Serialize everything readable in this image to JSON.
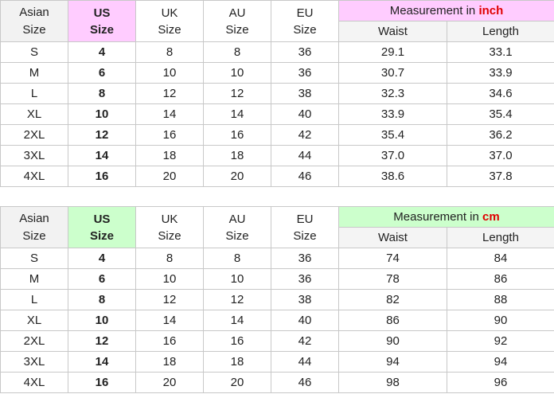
{
  "headers": {
    "asian_line1": "Asian",
    "asian_line2": "Size",
    "us_line1": "US",
    "us_line2": "Size",
    "uk_line1": "UK",
    "uk_line2": "Size",
    "au_line1": "AU",
    "au_line2": "Size",
    "eu_line1": "EU",
    "eu_line2": "Size",
    "measurement_prefix": "Measurement in ",
    "waist": "Waist",
    "length": "Length"
  },
  "tables": [
    {
      "unit": "inch",
      "us_header_color": "#ffccff",
      "measurement_header_color": "#ffccff",
      "rows": [
        {
          "asian": "S",
          "us": "4",
          "uk": "8",
          "au": "8",
          "eu": "36",
          "waist": "29.1",
          "length": "33.1"
        },
        {
          "asian": "M",
          "us": "6",
          "uk": "10",
          "au": "10",
          "eu": "36",
          "waist": "30.7",
          "length": "33.9"
        },
        {
          "asian": "L",
          "us": "8",
          "uk": "12",
          "au": "12",
          "eu": "38",
          "waist": "32.3",
          "length": "34.6"
        },
        {
          "asian": "XL",
          "us": "10",
          "uk": "14",
          "au": "14",
          "eu": "40",
          "waist": "33.9",
          "length": "35.4"
        },
        {
          "asian": "2XL",
          "us": "12",
          "uk": "16",
          "au": "16",
          "eu": "42",
          "waist": "35.4",
          "length": "36.2"
        },
        {
          "asian": "3XL",
          "us": "14",
          "uk": "18",
          "au": "18",
          "eu": "44",
          "waist": "37.0",
          "length": "37.0"
        },
        {
          "asian": "4XL",
          "us": "16",
          "uk": "20",
          "au": "20",
          "eu": "46",
          "waist": "38.6",
          "length": "37.8"
        }
      ]
    },
    {
      "unit": "cm",
      "us_header_color": "#ccffcc",
      "measurement_header_color": "#ccffcc",
      "rows": [
        {
          "asian": "S",
          "us": "4",
          "uk": "8",
          "au": "8",
          "eu": "36",
          "waist": "74",
          "length": "84"
        },
        {
          "asian": "M",
          "us": "6",
          "uk": "10",
          "au": "10",
          "eu": "36",
          "waist": "78",
          "length": "86"
        },
        {
          "asian": "L",
          "us": "8",
          "uk": "12",
          "au": "12",
          "eu": "38",
          "waist": "82",
          "length": "88"
        },
        {
          "asian": "XL",
          "us": "10",
          "uk": "14",
          "au": "14",
          "eu": "40",
          "waist": "86",
          "length": "90"
        },
        {
          "asian": "2XL",
          "us": "12",
          "uk": "16",
          "au": "16",
          "eu": "42",
          "waist": "90",
          "length": "92"
        },
        {
          "asian": "3XL",
          "us": "14",
          "uk": "18",
          "au": "18",
          "eu": "44",
          "waist": "94",
          "length": "94"
        },
        {
          "asian": "4XL",
          "us": "16",
          "uk": "20",
          "au": "20",
          "eu": "46",
          "waist": "98",
          "length": "96"
        }
      ]
    }
  ]
}
